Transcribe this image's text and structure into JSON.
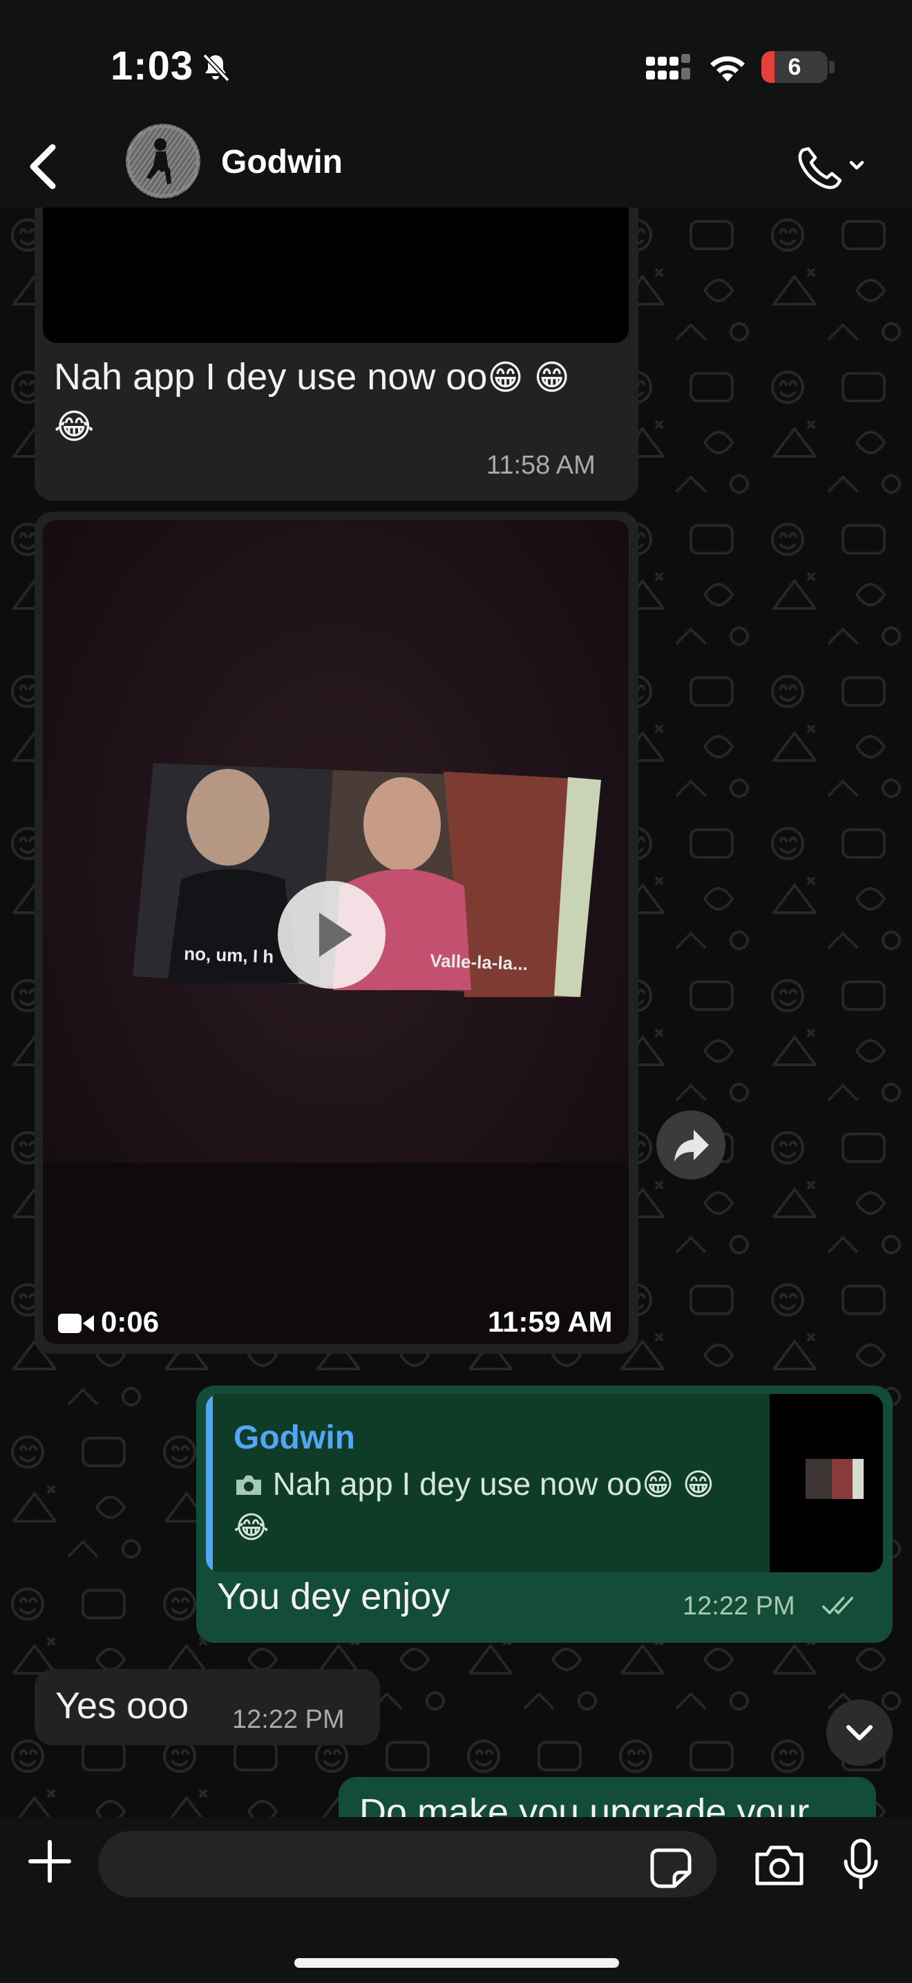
{
  "status_bar": {
    "time": "1:03",
    "battery_level": "6",
    "battery_fraction": 0.06
  },
  "header": {
    "contact_name": "Godwin",
    "icons": [
      "back-icon",
      "avatar",
      "phone-icon",
      "chevron-down-icon"
    ]
  },
  "messages": [
    {
      "direction": "incoming",
      "type": "photo-with-caption",
      "text": "Nah app I dey use now oo",
      "emojis": [
        "😁",
        "😁",
        "😂"
      ],
      "time": "11:58 AM"
    },
    {
      "direction": "incoming",
      "type": "video",
      "duration": "0:06",
      "subtitle_left": "no, um, I h",
      "subtitle_right": "Valle-la-la...",
      "time": "11:59 AM"
    },
    {
      "direction": "outgoing",
      "type": "reply",
      "quoted_name": "Godwin",
      "quoted_text": "Nah app I dey use now oo",
      "quoted_emojis": [
        "😁",
        "😁",
        "😂"
      ],
      "text": "You dey enjoy",
      "time": "12:22 PM",
      "status": "read"
    },
    {
      "direction": "incoming",
      "type": "text",
      "text": "Yes ooo",
      "time": "12:22 PM"
    },
    {
      "direction": "outgoing",
      "type": "text",
      "text": "Do make you upgrade your"
    }
  ],
  "composer": {
    "placeholder": "",
    "icons": [
      "plus-icon",
      "sticker-icon",
      "camera-icon",
      "microphone-icon"
    ]
  },
  "colors": {
    "incoming_bubble": "#202223",
    "outgoing_bubble": "#144d37",
    "quote_accent": "#53a6f3",
    "battery_low": "#e5403b"
  }
}
